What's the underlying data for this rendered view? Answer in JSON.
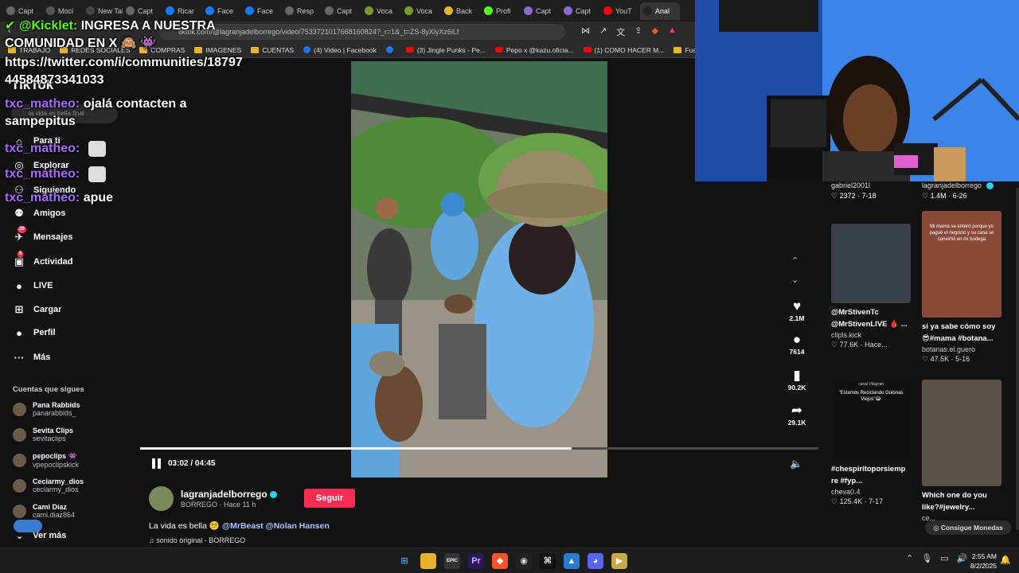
{
  "browser": {
    "tabs": [
      {
        "label": "Capt",
        "color": "#666"
      },
      {
        "label": "Moci",
        "color": "#555"
      },
      {
        "label": "New Tab",
        "color": "#444"
      },
      {
        "label": "Capt",
        "color": "#666"
      },
      {
        "label": "Ricar",
        "color": "#1877f2"
      },
      {
        "label": "Face",
        "color": "#1877f2"
      },
      {
        "label": "Face",
        "color": "#1877f2"
      },
      {
        "label": "Resp",
        "color": "#666"
      },
      {
        "label": "Capt",
        "color": "#666"
      },
      {
        "label": "Voca",
        "color": "#7a9a2a"
      },
      {
        "label": "Voca",
        "color": "#7a9a2a"
      },
      {
        "label": "Back",
        "color": "#e7b32a"
      },
      {
        "label": "Profi",
        "color": "#53fc18"
      },
      {
        "label": "Capt",
        "color": "#8a6ad0"
      },
      {
        "label": "Capt",
        "color": "#8a6ad0"
      },
      {
        "label": "YouT",
        "color": "#ff0000"
      },
      {
        "label": "Anal",
        "color": "#222"
      }
    ],
    "url": "tiktok.com/@lagranjadelborrego/video/7533721017668160824?_r=1&_t=ZS-8yXlyXz6lLf",
    "bookmarks": [
      {
        "label": "TRABAJO",
        "kind": "folder"
      },
      {
        "label": "REDES SOCIALES",
        "kind": "folder"
      },
      {
        "label": "COMPRAS",
        "kind": "folder"
      },
      {
        "label": "IMAGENES",
        "kind": "folder"
      },
      {
        "label": "CUENTAS",
        "kind": "folder"
      },
      {
        "label": "(4) Video | Facebook",
        "kind": "fb"
      },
      {
        "label": "",
        "kind": "fb"
      },
      {
        "label": "(3) Jingle Punks - Pe...",
        "kind": "yt"
      },
      {
        "label": "Pepo x @kazu.oficia...",
        "kind": "yt"
      },
      {
        "label": "(1) COMO HACER M...",
        "kind": "yt"
      },
      {
        "label": "Fusion Chat - Kic",
        "kind": "folder"
      }
    ]
  },
  "sidebar": {
    "logo": "TikTok",
    "search_placeholder": "la vida es bella final",
    "nav": [
      {
        "label": "Para ti",
        "icon": "home-icon",
        "glyph": "⌂",
        "badge": ""
      },
      {
        "label": "Explorar",
        "icon": "compass-icon",
        "glyph": "◎",
        "badge": ""
      },
      {
        "label": "Siguiendo",
        "icon": "following-icon",
        "glyph": "⚇",
        "badge": ""
      },
      {
        "label": "Amigos",
        "icon": "friends-icon",
        "glyph": "⚉",
        "badge": ""
      },
      {
        "label": "Mensajes",
        "icon": "messages-icon",
        "glyph": "✈",
        "badge": "29"
      },
      {
        "label": "Actividad",
        "icon": "activity-icon",
        "glyph": "▣",
        "badge": "5"
      },
      {
        "label": "LIVE",
        "icon": "live-icon",
        "glyph": "●",
        "badge": ""
      },
      {
        "label": "Cargar",
        "icon": "upload-icon",
        "glyph": "⊞",
        "badge": ""
      },
      {
        "label": "Perfil",
        "icon": "profile-icon",
        "glyph": "●",
        "badge": ""
      },
      {
        "label": "Más",
        "icon": "more-icon",
        "glyph": "···",
        "badge": ""
      }
    ],
    "following_title": "Cuentas que sigues",
    "accounts": [
      {
        "name": "Pana Rabbids",
        "handle": "panarabbids_"
      },
      {
        "name": "Sevita Clips",
        "handle": "sevitaclips"
      },
      {
        "name": "pepoclips 👾",
        "handle": "vpepoclipskick"
      },
      {
        "name": "Ceciarmy_dios",
        "handle": "ceciarmy_dios"
      },
      {
        "name": "Cami Diaz",
        "handle": "cami.diaz864"
      }
    ],
    "see_more": "Ver más"
  },
  "player": {
    "time": "03:02 / 04:45",
    "progress": 0.636,
    "actions": [
      {
        "icon": "heart-icon",
        "glyph": "♥",
        "count": "2.1M"
      },
      {
        "icon": "comment-icon",
        "glyph": "●",
        "count": "7614"
      },
      {
        "icon": "bookmark-icon",
        "glyph": "▮",
        "count": "90.2K"
      },
      {
        "icon": "share-icon",
        "glyph": "➦",
        "count": "29.1K"
      }
    ]
  },
  "video_info": {
    "author": "lagranjadelborrego",
    "sub": "BORREGO · Hace 11 h",
    "follow_label": "Seguir",
    "caption": "La vida es bella 😵‍💫",
    "mentions": "@MrBeast @Nolan Hansen",
    "music": "♫ sonido original - BORREGO"
  },
  "right_panel": {
    "top": [
      {
        "user": "gabriel2001l",
        "stats": "♡ 2372 · 7-18"
      },
      {
        "user": "lagranjadelborrego",
        "stats": "♡ 1.4M · 6-26"
      }
    ],
    "cards": [
      {
        "title1": "@MrStivenTc",
        "title2": "@MrStivenLIVE 🩸 ...",
        "user": "clipls.kick",
        "stats": "♡ 77.6K · Hace...",
        "bg": "#3a4048"
      },
      {
        "title1": "si ya sabe cómo soy",
        "title2": "😎#mama #botana...",
        "user": "botanas.el.guero",
        "stats": "♡ 47.5K · 5-16",
        "bg": "#8a4a3a"
      },
      {
        "title1": "#chespiritoporsiemp",
        "title2": "re #fyp...",
        "user": "cheva0.4",
        "stats": "♡ 125.4K · 7-17",
        "bg": "#111"
      },
      {
        "title1": "Which one do you",
        "title2": "like?#jewelry...",
        "user": "ce...",
        "stats": "",
        "bg": "#5a5248"
      }
    ],
    "card1_overlay": "Mi mamá se enteró porque yo pagué el negocio y su casa se convirtió en mi bodega",
    "card3_overlay": "\"Estamos Reciclando Gulonas Viejos\"😂",
    "card3_channel": "canal Vilagran",
    "coins": "Consigue Monedas"
  },
  "chat": [
    {
      "user": "@Kicklet",
      "text": "INGRESA A NUESTRA",
      "color": "#53fc18"
    },
    {
      "user": "",
      "text": "COMUNIDAD EN X 🙈 👾",
      "color": ""
    },
    {
      "user": "",
      "text": "https://twitter.com/i/communities/18797",
      "color": ""
    },
    {
      "user": "",
      "text": "44584873341033",
      "color": ""
    },
    {
      "user": "txc_matheo",
      "text": "ojalá contacten a",
      "color": "#a56bff"
    },
    {
      "user": "",
      "text": "sampepitus",
      "color": ""
    },
    {
      "user": "txc_matheo",
      "text": "",
      "color": "#a56bff"
    },
    {
      "user": "txc_matheo",
      "text": "",
      "color": "#a56bff"
    },
    {
      "user": "txc_matheo",
      "text": "apue",
      "color": "#a56bff"
    }
  ],
  "taskbar": {
    "apps": [
      {
        "name": "windows-start-icon",
        "glyph": "⊞",
        "bg": "transparent",
        "color": "#3fa9f5"
      },
      {
        "name": "file-explorer-icon",
        "glyph": "▬",
        "bg": "#e7b32a",
        "color": "#e7b32a"
      },
      {
        "name": "epic-games-icon",
        "glyph": "EPIC",
        "bg": "#333",
        "color": "#fff"
      },
      {
        "name": "premiere-icon",
        "glyph": "Pr",
        "bg": "#2a1a5a",
        "color": "#c8a8ff"
      },
      {
        "name": "brave-icon",
        "glyph": "◆",
        "bg": "#fb542b",
        "color": "#fff"
      },
      {
        "name": "obs-icon",
        "glyph": "◉",
        "bg": "#222",
        "color": "#ddd"
      },
      {
        "name": "capcut-icon",
        "glyph": "⌘",
        "bg": "#111",
        "color": "#fff"
      },
      {
        "name": "app-icon",
        "glyph": "▲",
        "bg": "#2a7ad0",
        "color": "#fff"
      },
      {
        "name": "discord-icon",
        "glyph": "◕",
        "bg": "#5865f2",
        "color": "#fff"
      },
      {
        "name": "media-icon",
        "glyph": "▶",
        "bg": "#c8a848",
        "color": "#fff"
      }
    ],
    "time": "2:55 AM",
    "date": "8/2/2025"
  }
}
